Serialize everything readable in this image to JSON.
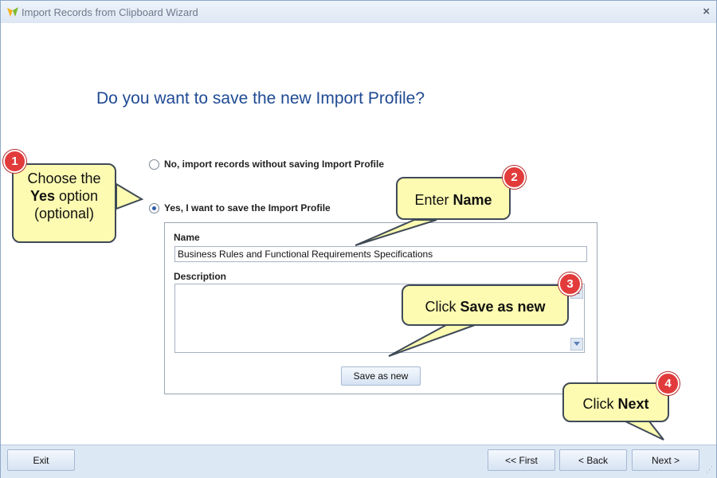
{
  "window": {
    "title": "Import Records from Clipboard Wizard"
  },
  "main": {
    "question": "Do you want to save the new Import Profile?",
    "options": [
      {
        "label": "No, import records without saving Import Profile",
        "selected": false
      },
      {
        "label": "Yes, I want to save the Import Profile",
        "selected": true
      }
    ],
    "name_label": "Name",
    "name_value": "Business Rules and Functional Requirements Specifications",
    "description_label": "Description",
    "description_value": "",
    "save_as_new": "Save as new"
  },
  "footer": {
    "exit": "Exit",
    "first": "<< First",
    "back": "< Back",
    "next": "Next >"
  },
  "callouts": [
    {
      "number": "1",
      "line1": "Choose the",
      "line2_bold": "Yes",
      "line2_rest": " option",
      "line3": "(optional)"
    },
    {
      "number": "2",
      "prefix": "Enter ",
      "bold": "Name"
    },
    {
      "number": "3",
      "prefix": "Click ",
      "bold": "Save as new"
    },
    {
      "number": "4",
      "prefix": "Click ",
      "bold": "Next"
    }
  ],
  "colors": {
    "question": "#1f4a93",
    "callout_fill": "#fdfbb1",
    "badge": "#e23b3b",
    "radio_dot": "#2a5ca8"
  }
}
